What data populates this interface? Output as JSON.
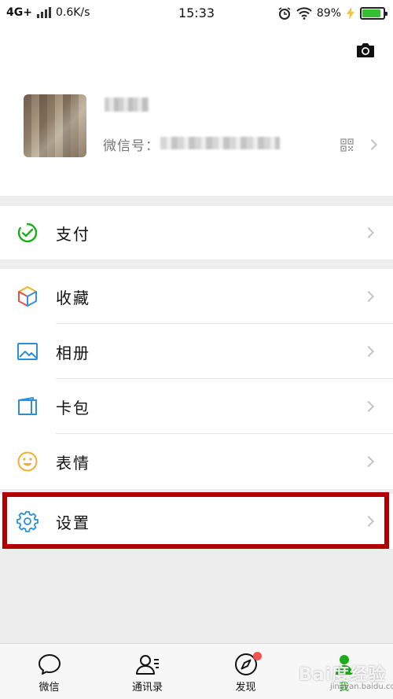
{
  "status_bar": {
    "network": "4G+",
    "speed": "0.6K/s",
    "time": "15:33",
    "battery": "89%",
    "battery_level": 0.89
  },
  "profile": {
    "wechat_id_label": "微信号："
  },
  "menu": {
    "pay": "支付",
    "favorites": "收藏",
    "album": "相册",
    "cards": "卡包",
    "stickers": "表情",
    "settings": "设置"
  },
  "tabs": [
    {
      "label": "微信"
    },
    {
      "label": "通讯录"
    },
    {
      "label": "发现"
    },
    {
      "label": "我"
    }
  ],
  "watermark": {
    "text": "Bai度经验",
    "sub": "jingyan.baidu.com"
  },
  "colors": {
    "accent": "#1aad19",
    "highlight": "#b00000",
    "badge": "#f05350"
  }
}
